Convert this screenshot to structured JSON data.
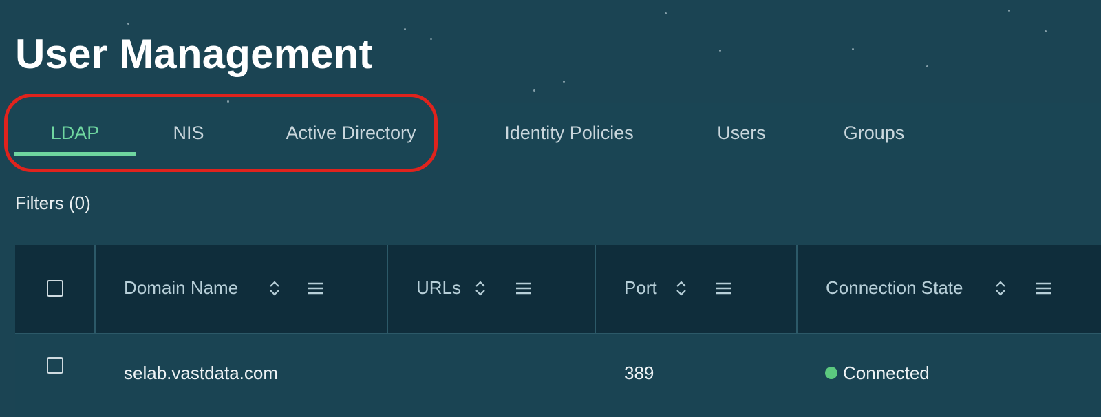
{
  "page": {
    "title": "User Management"
  },
  "tabs": [
    {
      "label": "LDAP",
      "active": true
    },
    {
      "label": "NIS",
      "active": false
    },
    {
      "label": "Active Directory",
      "active": false
    },
    {
      "label": "Identity Policies",
      "active": false
    },
    {
      "label": "Users",
      "active": false
    },
    {
      "label": "Groups",
      "active": false
    }
  ],
  "filters": {
    "label": "Filters (0)"
  },
  "table": {
    "columns": [
      {
        "label": "Domain Name",
        "sort_icon": "sort-icon",
        "menu_icon": "menu-icon"
      },
      {
        "label": "URLs",
        "sort_icon": "sort-icon",
        "menu_icon": "menu-icon"
      },
      {
        "label": "Port",
        "sort_icon": "sort-icon",
        "menu_icon": "menu-icon"
      },
      {
        "label": "Connection State",
        "sort_icon": "sort-icon",
        "menu_icon": "menu-icon"
      }
    ],
    "rows": [
      {
        "domain_name": "selab.vastdata.com",
        "urls": "",
        "port": "389",
        "connection_state": "Connected"
      }
    ]
  },
  "colors": {
    "accent": "#6fd6a0",
    "status_connected": "#5cc97f",
    "highlight": "#e0231d"
  }
}
